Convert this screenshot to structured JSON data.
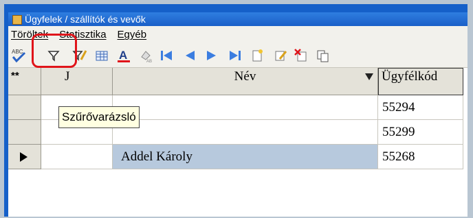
{
  "window": {
    "title": "Ügyfelek / szállítók és vevők"
  },
  "menu": {
    "items": [
      "Töröltek",
      "Statisztika",
      "Egyéb"
    ]
  },
  "toolbar": {
    "buttons": [
      "spellcheck-icon",
      "filter-icon",
      "filter-wizard-icon",
      "grid-icon",
      "font-color-icon",
      "highlight-icon",
      "first-record-icon",
      "previous-record-icon",
      "next-record-icon",
      "last-record-icon",
      "new-record-icon",
      "edit-record-icon",
      "delete-record-icon",
      "copy-icon"
    ],
    "highlight_color": "#e0141a"
  },
  "tooltip": {
    "text": "Szűrővarázsló"
  },
  "grid": {
    "columns": {
      "marker": "**",
      "col1": "J",
      "name": "Név",
      "code": "Ügyfélkód"
    },
    "rows": [
      {
        "name": "",
        "code": "55294",
        "current": false
      },
      {
        "name": "",
        "code": "55299",
        "current": false
      },
      {
        "name": "Addel Károly",
        "code": "55268",
        "current": true
      }
    ],
    "selected_color": "#b7c9dd"
  }
}
